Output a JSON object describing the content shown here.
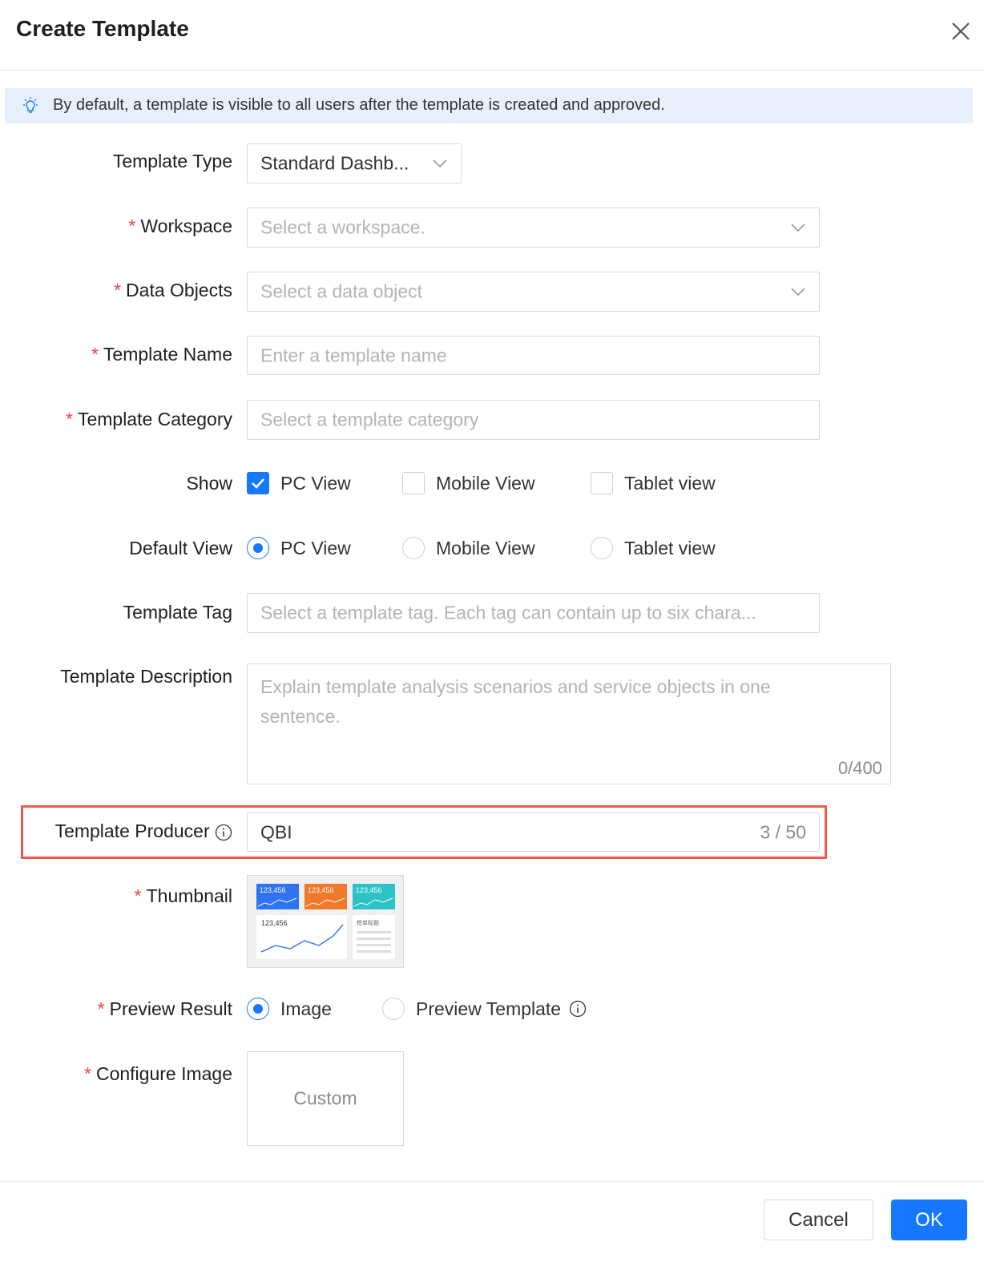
{
  "dialog": {
    "title": "Create Template",
    "notice": "By default, a template is visible to all users after the template is created and approved."
  },
  "form": {
    "template_type": {
      "label": "Template Type",
      "value": "Standard Dashb..."
    },
    "workspace": {
      "label": "Workspace",
      "placeholder": "Select a workspace.",
      "required": true
    },
    "data_objects": {
      "label": "Data Objects",
      "placeholder": "Select a data object",
      "required": true
    },
    "template_name": {
      "label": "Template Name",
      "placeholder": "Enter a template name",
      "required": true
    },
    "template_category": {
      "label": "Template Category",
      "placeholder": "Select a template category",
      "required": true
    },
    "show": {
      "label": "Show",
      "options": [
        {
          "label": "PC View",
          "checked": true
        },
        {
          "label": "Mobile View",
          "checked": false
        },
        {
          "label": "Tablet view",
          "checked": false
        }
      ]
    },
    "default_view": {
      "label": "Default View",
      "options": [
        {
          "label": "PC View",
          "selected": true
        },
        {
          "label": "Mobile View",
          "selected": false
        },
        {
          "label": "Tablet view",
          "selected": false
        }
      ]
    },
    "template_tag": {
      "label": "Template Tag",
      "placeholder": "Select a template tag. Each tag can contain up to six chara..."
    },
    "template_description": {
      "label": "Template Description",
      "placeholder_line1": "Explain template analysis scenarios and service objects in one",
      "placeholder_line2": "sentence.",
      "counter": "0/400"
    },
    "template_producer": {
      "label": "Template Producer",
      "value": "QBI",
      "counter": "3 / 50"
    },
    "thumbnail": {
      "label": "Thumbnail",
      "required": true,
      "tiles": [
        "123,456",
        "123,456",
        "123,456"
      ],
      "main_value": "123,456",
      "list_title": "榜单标题"
    },
    "preview_result": {
      "label": "Preview Result",
      "required": true,
      "options": [
        {
          "label": "Image",
          "selected": true
        },
        {
          "label": "Preview Template",
          "selected": false
        }
      ]
    },
    "configure_image": {
      "label": "Configure Image",
      "required": true,
      "button": "Custom"
    }
  },
  "footer": {
    "cancel": "Cancel",
    "ok": "OK"
  },
  "colors": {
    "primary": "#1677ff",
    "required": "#ef4444",
    "highlight": "#ef5a4b",
    "notice_bg": "#e8f0fe"
  }
}
